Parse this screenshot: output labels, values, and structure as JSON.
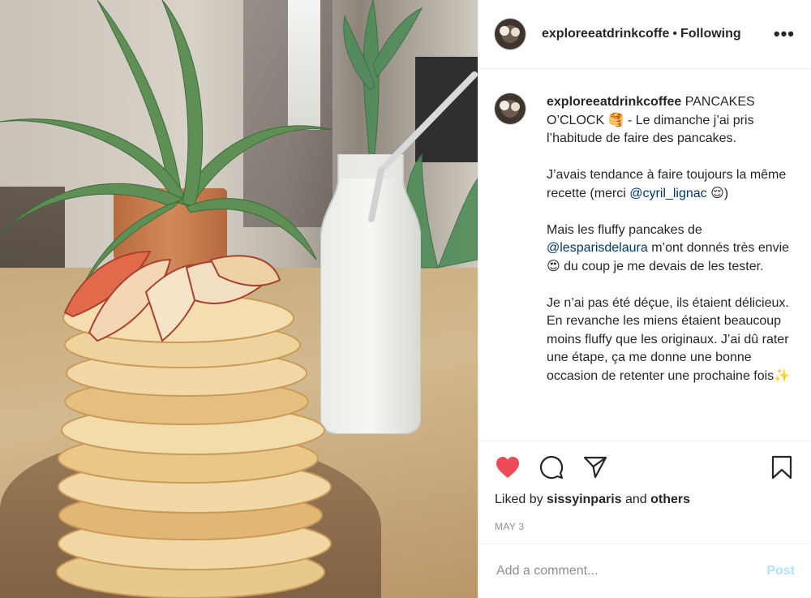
{
  "post": {
    "username": "exploreeatdrinkcoffee",
    "username_truncated": "exploreeatdrinkcoffe",
    "dot": "•",
    "follow_state": "Following",
    "more_icon": "•••"
  },
  "caption": {
    "username": "exploreeatdrinkcoffee",
    "paragraphs": [
      {
        "text": " PANCAKES O’CLOCK 🥞 - Le dimanche j’ai pris l’habitude de faire des pancakes."
      },
      {
        "before": "J’avais tendance à faire toujours la même recette (merci ",
        "mention": "@cyril_lignac",
        "after": " 😌)"
      },
      {
        "before": "Mais les fluffy pancakes de ",
        "mention": "@lesparisdelaura",
        "after": " m’ont donnés très envie 😍 du coup je me devais de les tester."
      },
      {
        "text": "Je n’ai pas été déçue, ils étaient délicieux. En revanche les miens étaient beaucoup moins fluffy que les originaux. J’ai dû rater une étape, ça me donne une bonne occasion de retenter une prochaine fois✨"
      }
    ]
  },
  "likes": {
    "prefix": "Liked by ",
    "user": "sissyinparis",
    "mid": " and ",
    "others": "others"
  },
  "date": "MAY 3",
  "add_comment": {
    "placeholder": "Add a comment...",
    "post_label": "Post"
  },
  "colors": {
    "heart": "#ed4956",
    "link": "#00376b",
    "post_disabled": "#b2dffc",
    "muted": "#8e8e8e"
  }
}
